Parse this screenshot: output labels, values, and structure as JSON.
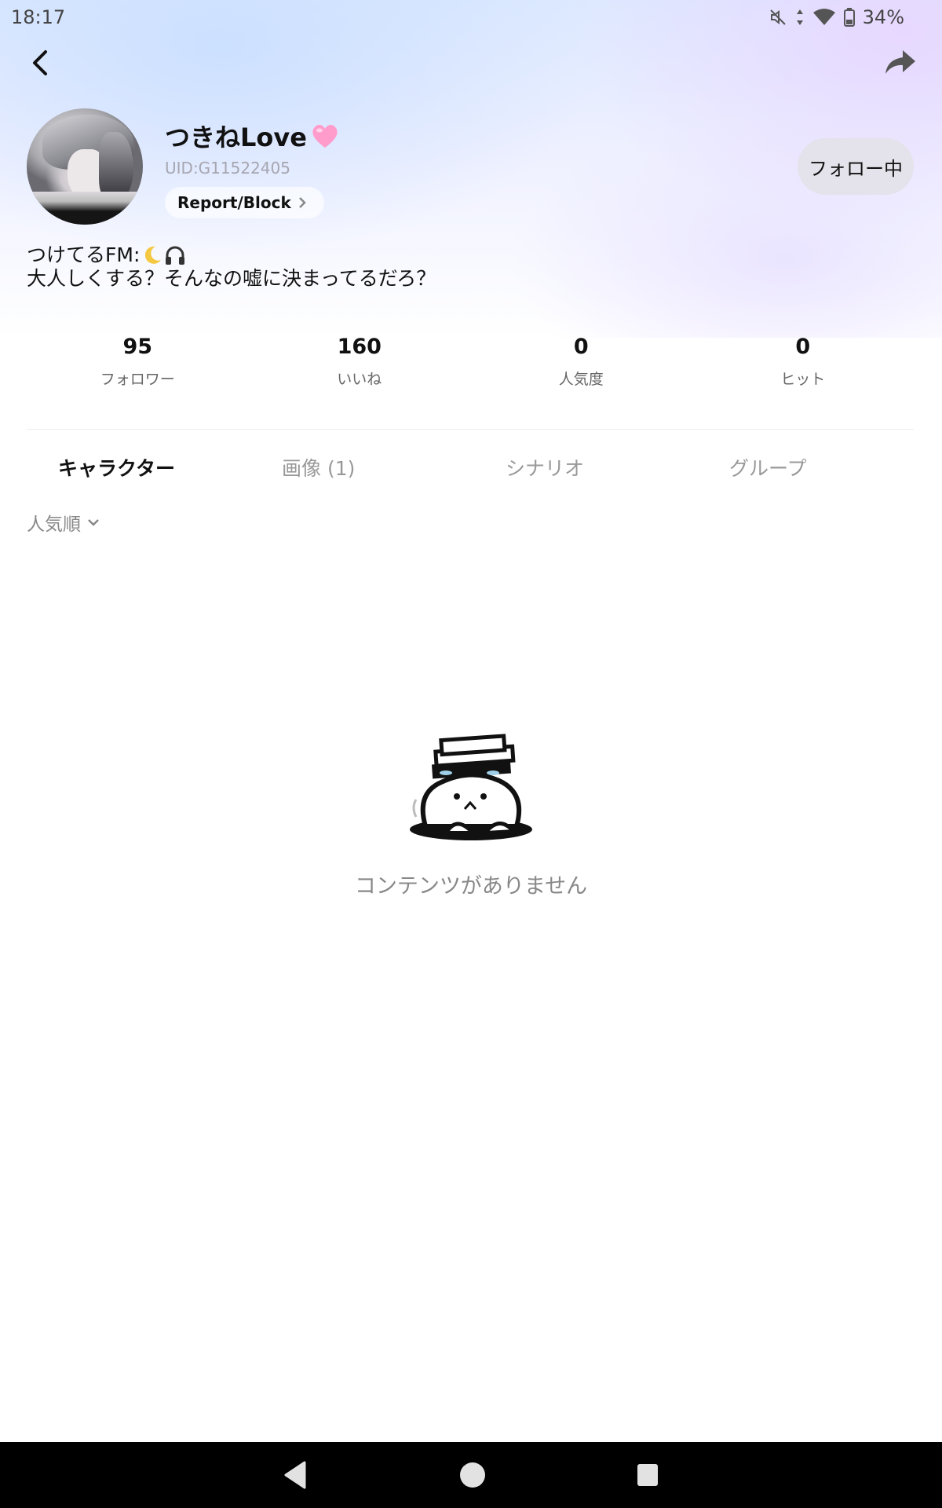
{
  "status_bar": {
    "time": "18:17",
    "battery_percent": "34%",
    "icons": [
      "mute-icon",
      "data-arrows-icon",
      "wifi-icon",
      "battery-icon"
    ]
  },
  "header": {
    "back_icon": "chevron-left-icon",
    "share_icon": "share-arrow-icon"
  },
  "profile": {
    "name": "つきねLove",
    "name_emoji": "pink-heart",
    "uid": "UID:G11522405",
    "report_label": "Report/Block",
    "follow_label": "フォロー中",
    "bio_line1": "つけてるFM:",
    "bio_line1_emojis": [
      "crescent-moon",
      "headphones"
    ],
    "bio_line2": "大人しくする？そんなの嘘に決まってるだろ？"
  },
  "stats": [
    {
      "value": "95",
      "label": "フォロワー"
    },
    {
      "value": "160",
      "label": "いいね"
    },
    {
      "value": "0",
      "label": "人気度"
    },
    {
      "value": "0",
      "label": "ヒット"
    }
  ],
  "tabs": [
    {
      "label": "キャラクター",
      "active": true
    },
    {
      "label": "画像 (1)",
      "active": false
    },
    {
      "label": "シナリオ",
      "active": false
    },
    {
      "label": "グループ",
      "active": false
    }
  ],
  "sort": {
    "label": "人気順"
  },
  "empty_state": {
    "text": "コンテンツがありません"
  },
  "colors": {
    "follow_button_bg": "#e4e2ea",
    "heart": "#ff8fc4",
    "moon": "#f5c842"
  }
}
